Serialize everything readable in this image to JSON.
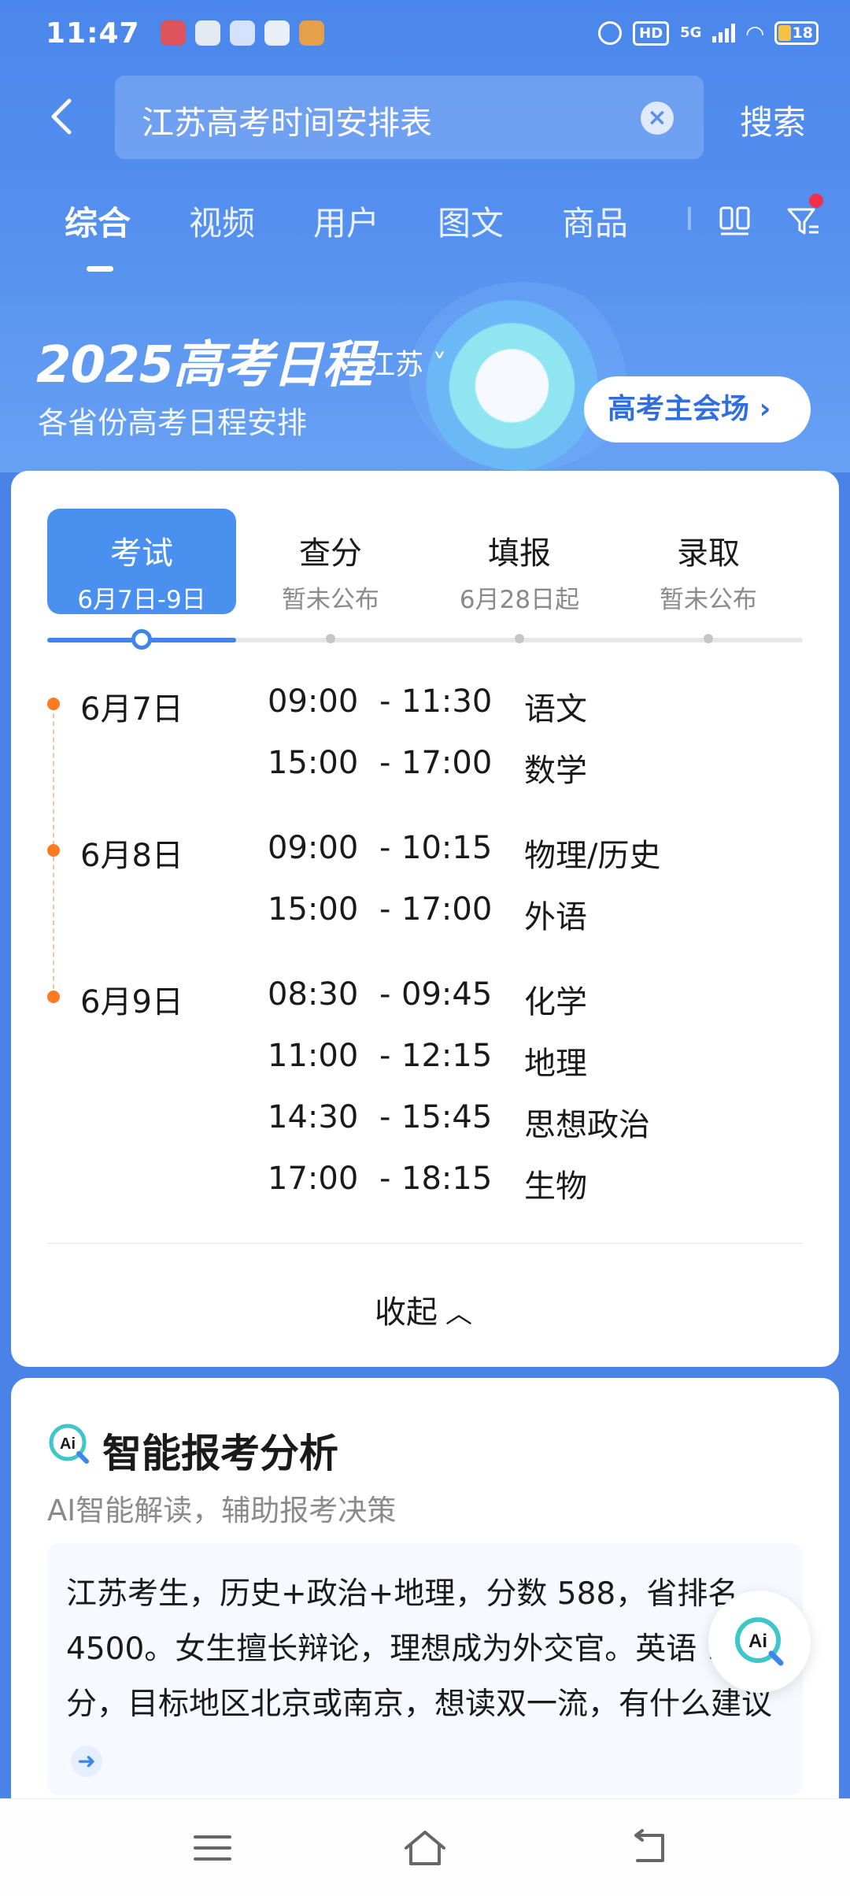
{
  "status_bar": {
    "time": "11:47",
    "network_badge": "HD",
    "network_type": "5G",
    "battery": "18"
  },
  "search": {
    "query": "江苏高考时间安排表",
    "submit_label": "搜索"
  },
  "tabs": [
    {
      "label": "综合",
      "active": true
    },
    {
      "label": "视频"
    },
    {
      "label": "用户"
    },
    {
      "label": "图文"
    },
    {
      "label": "商品"
    }
  ],
  "banner": {
    "title": "2025高考日程",
    "province": "江苏",
    "subtitle": "各省份高考日程安排",
    "cta": "高考主会场"
  },
  "stages": [
    {
      "title": "考试",
      "date": "6月7日-9日",
      "active": true
    },
    {
      "title": "查分",
      "date": "暂未公布"
    },
    {
      "title": "填报",
      "date": "6月28日起"
    },
    {
      "title": "录取",
      "date": "暂未公布"
    }
  ],
  "schedule": [
    {
      "day": "6月7日",
      "slots": [
        {
          "start": "09:00",
          "end": "11:30",
          "subject": "语文"
        },
        {
          "start": "15:00",
          "end": "17:00",
          "subject": "数学"
        }
      ]
    },
    {
      "day": "6月8日",
      "slots": [
        {
          "start": "09:00",
          "end": "10:15",
          "subject": "物理/历史"
        },
        {
          "start": "15:00",
          "end": "17:00",
          "subject": "外语"
        }
      ]
    },
    {
      "day": "6月9日",
      "slots": [
        {
          "start": "08:30",
          "end": "09:45",
          "subject": "化学"
        },
        {
          "start": "11:00",
          "end": "12:15",
          "subject": "地理"
        },
        {
          "start": "14:30",
          "end": "15:45",
          "subject": "思想政治"
        },
        {
          "start": "17:00",
          "end": "18:15",
          "subject": "生物"
        }
      ]
    }
  ],
  "collapse_label": "收起",
  "ai_card": {
    "title": "智能报考分析",
    "subtitle": "AI智能解读，辅助报考决策",
    "query": "江苏考生，历史+政治+地理，分数 588，省排名 4500。女生擅长辩论，理想成为外交官。英语 140 分，目标地区北京或南京，想读双一流，有什么建议"
  },
  "colors": {
    "brand_blue": "#4a82e8",
    "accent_blue": "#3e86ec",
    "timeline_orange": "#ff7a21"
  }
}
